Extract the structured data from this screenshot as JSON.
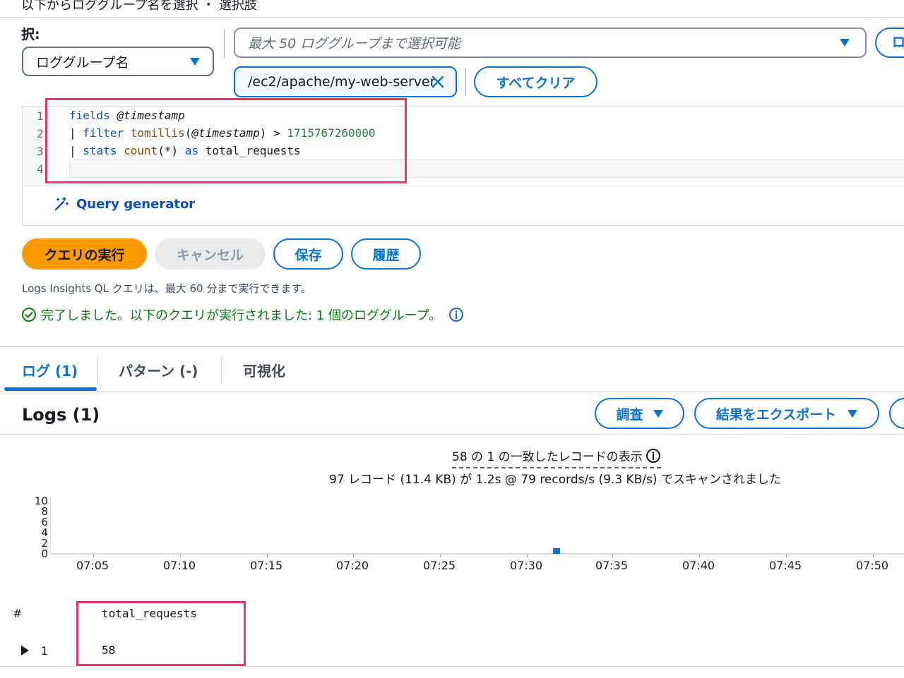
{
  "query_section": {
    "top_fragment": "以下からロググループ名を選択 ・ 選択肢",
    "select_label": "択:",
    "selection_mode": "ロググループ名",
    "log_group_placeholder": "最大 50 ロググループまで選択可能",
    "right_button_label": "ロ",
    "selected_token": "/ec2/apache/my-web-server",
    "clear_all_label": "すべてクリア"
  },
  "editor": {
    "line_numbers": [
      "1",
      "2",
      "3",
      "4"
    ],
    "line1_kw": "fields",
    "line1_field": "@timestamp",
    "line2_pipe": "|",
    "line2_kw": "filter",
    "line2_fn": "tomillis",
    "line2_field": "@timestamp",
    "line2_op": ">",
    "line2_num": "1715767260000",
    "line3_pipe": "|",
    "line3_kw": "stats",
    "line3_fn": "count",
    "line3_arg": "(*)",
    "line3_as": "as",
    "line3_alias": "total_requests",
    "query_generator_label": "Query generator"
  },
  "actions": {
    "run": "クエリの実行",
    "cancel": "キャンセル",
    "save": "保存",
    "history": "履歴"
  },
  "status": {
    "hint": "Logs Insights QL クエリは、最大 60 分まで実行できます。",
    "success": "完了しました。以下のクエリが実行されました: 1 個のロググループ。"
  },
  "tabs": [
    {
      "label": "ログ (1)",
      "active": true
    },
    {
      "label": "パターン (-)",
      "active": false
    },
    {
      "label": "可視化",
      "active": false
    }
  ],
  "logs_panel": {
    "title": "Logs (1)",
    "investigate_label": "調査",
    "export_label": "結果をエクスポート",
    "summary_matched": "58 の 1 の一致したレコードの表示",
    "summary_scanned": "97 レコード (11.4 KB) が 1.2s @ 79 records/s (9.3 KB/s) でスキャンされました"
  },
  "chart_data": {
    "type": "bar",
    "yticks": [
      "10",
      "8",
      "6",
      "4",
      "2",
      "0"
    ],
    "ylim": [
      0,
      10
    ],
    "xticks": [
      "07:05",
      "07:10",
      "07:15",
      "07:20",
      "07:25",
      "07:30",
      "07:35",
      "07:40",
      "07:45",
      "07:50"
    ],
    "series": [
      {
        "x": [
          "07:32"
        ],
        "values": [
          1
        ]
      }
    ]
  },
  "results_table": {
    "columns": [
      "#",
      "total_requests"
    ],
    "rows": [
      {
        "index": "1",
        "total_requests": "58"
      }
    ]
  },
  "colors": {
    "accent": "#0972d3",
    "run_button": "#ff9900",
    "success": "#037f0c",
    "highlight_box": "#e8336e"
  }
}
